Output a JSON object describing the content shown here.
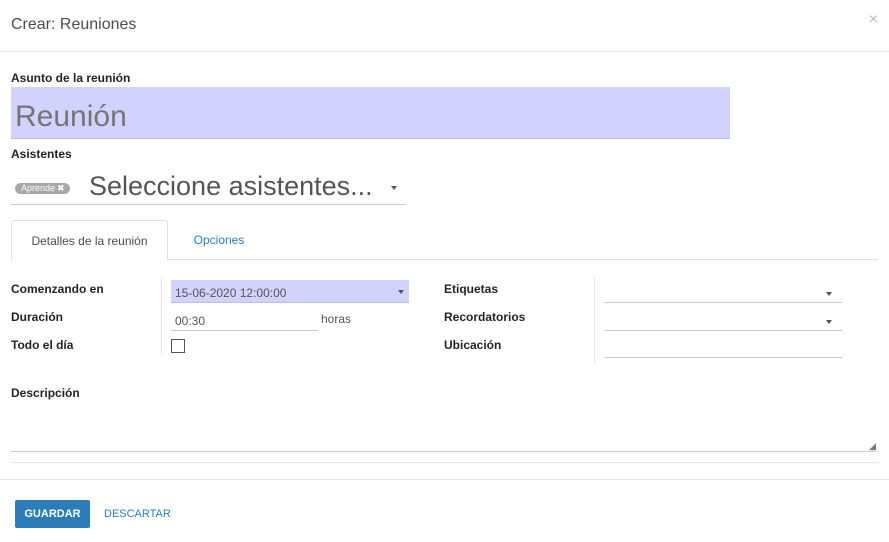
{
  "modal": {
    "title": "Crear: Reuniones",
    "close_symbol": "×"
  },
  "subject": {
    "label": "Asunto de la reunión",
    "placeholder": "Reunión"
  },
  "attendees": {
    "label": "Asistentes",
    "tag": "Aprende",
    "tag_remove": "✖",
    "placeholder": "Seleccione asistentes..."
  },
  "tabs": [
    {
      "label": "Detalles de la reunión",
      "active": true
    },
    {
      "label": "Opciones",
      "active": false
    }
  ],
  "details": {
    "start_label": "Comenzando en",
    "start_value": "15-06-2020 12:00:00",
    "duration_label": "Duración",
    "duration_value": "00:30",
    "duration_unit": "horas",
    "allday_label": "Todo el día",
    "allday_checked": false,
    "tags_label": "Etiquetas",
    "reminders_label": "Recordatorios",
    "location_label": "Ubicación"
  },
  "description": {
    "label": "Descripción"
  },
  "footer": {
    "save_label": "GUARDAR",
    "discard_label": "DESCARTAR"
  },
  "colors": {
    "primary": "#2c7cb8",
    "highlight": "#d2d2ff",
    "tag": "#a8a8a8"
  },
  "icons": {
    "close": "close-icon",
    "dropdown": "caret-down-icon",
    "resize": "resize-grip-icon"
  }
}
